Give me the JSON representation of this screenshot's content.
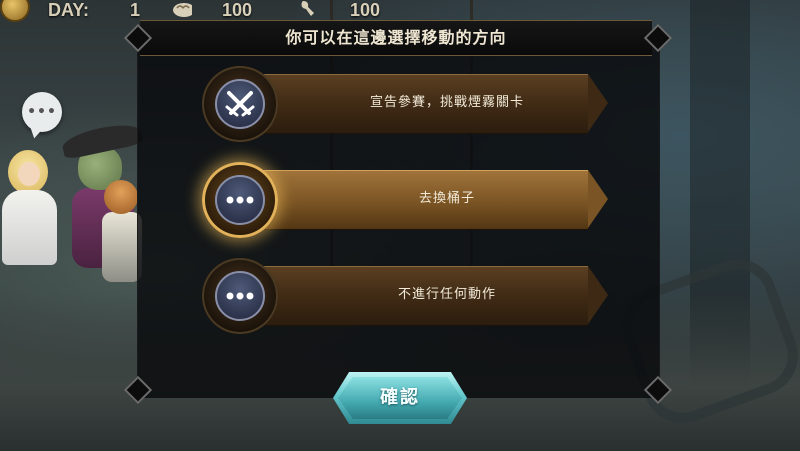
{
  "hud": {
    "day_label": "DAY:",
    "day_value": "1",
    "bread_value": "100",
    "tool_value": "100"
  },
  "chat": {
    "icon": "chat-bubble-icon",
    "text": "•••"
  },
  "dialog": {
    "title": "你可以在這邊選擇移動的方向",
    "options": [
      {
        "label": "宣告參賽，挑戰煙霧關卡",
        "icon": "crossed-swords-icon",
        "selected": false
      },
      {
        "label": "去換桶子",
        "icon": "ellipsis-icon",
        "selected": true
      },
      {
        "label": "不進行任何動作",
        "icon": "ellipsis-icon",
        "selected": false
      }
    ],
    "confirm_label": "確認"
  },
  "colors": {
    "banner_gold": "#7a5424",
    "banner_dark": "#3e2914",
    "confirm_teal": "#63c8cc",
    "icon_blue": "#4e5a78"
  }
}
